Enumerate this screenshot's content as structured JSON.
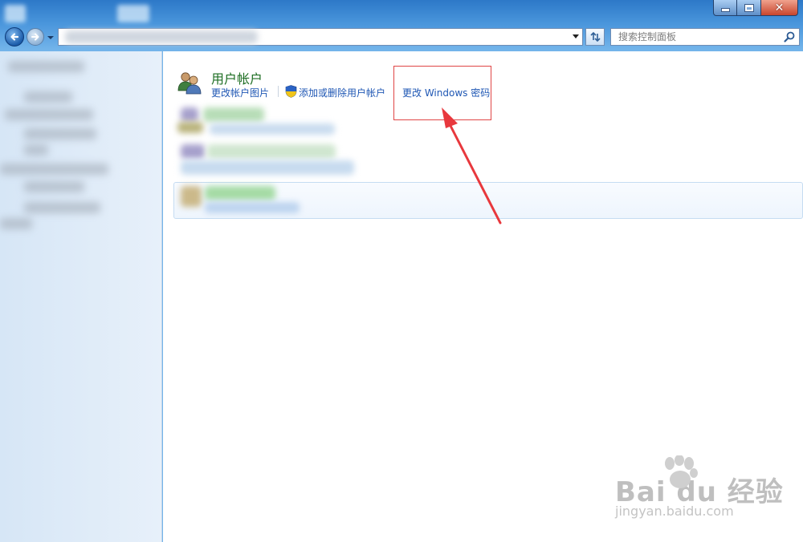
{
  "window": {
    "controls": {
      "minimize": "minimize",
      "maximize": "maximize",
      "close": "close"
    }
  },
  "navigation": {
    "search_placeholder": "搜索控制面板"
  },
  "main": {
    "section_title": "用户帐户",
    "links": {
      "change_picture": "更改帐户图片",
      "add_remove": "添加或删除用户帐户",
      "change_password": "更改 Windows 密码"
    }
  },
  "annotation": {
    "highlight_color": "#e04545",
    "arrow_color": "#e8383d"
  },
  "watermark": {
    "logo": "Bai du 经验",
    "url": "jingyan.baidu.com"
  },
  "colors": {
    "title_green": "#1e6e23",
    "link_blue": "#1f57b4",
    "chrome_blue": "#4a96dc"
  }
}
